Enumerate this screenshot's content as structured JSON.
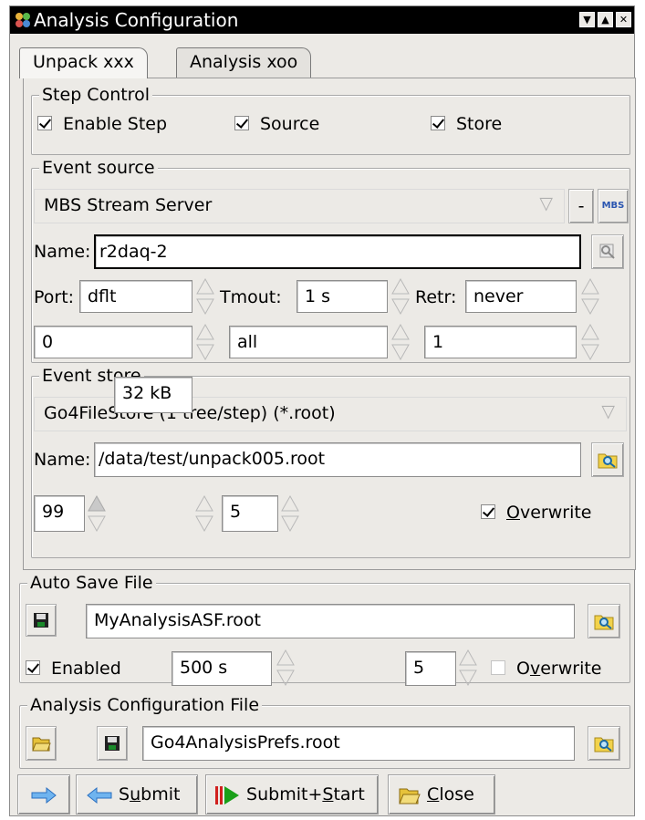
{
  "window": {
    "title": "Analysis Configuration"
  },
  "tabs": [
    {
      "label": "Unpack xxx",
      "active": true
    },
    {
      "label": "Analysis xoo",
      "active": false
    }
  ],
  "step_control": {
    "label": "Step Control",
    "checkboxes": [
      {
        "label": "Enable Step",
        "checked": true
      },
      {
        "label": "Source",
        "checked": true
      },
      {
        "label": "Store",
        "checked": true
      }
    ]
  },
  "event_source": {
    "label": "Event source",
    "type_value": "MBS Stream Server",
    "minus_label": "-",
    "mbs_label": "MBS",
    "name_label": "Name:",
    "name_value": "r2daq-2",
    "port_label": "Port:",
    "port_value": "dflt",
    "tmout_label": "Tmout:",
    "tmout_value": "1 s",
    "retr_label": "Retr:",
    "retr_value": "never",
    "row4_values": [
      "0",
      "all",
      "1"
    ]
  },
  "event_store": {
    "label": "Event store",
    "type_value": "Go4FileStore (1 tree/step) (*.root)",
    "name_label": "Name:",
    "name_value": "/data/test/unpack005.root",
    "spin_values": [
      "99",
      "32 kB",
      "5"
    ],
    "overwrite_label": "Overwrite",
    "overwrite_mnemonic": "O",
    "overwrite_rest": "verwrite",
    "overwrite_checked": true
  },
  "auto_save": {
    "label": "Auto Save File",
    "file_value": "MyAnalysisASF.root",
    "enabled_label": "Enabled",
    "enabled_checked": true,
    "interval_value": "500 s",
    "compression_value": "5",
    "overwrite_label": "Overwrite",
    "overwrite_pre": "O",
    "overwrite_mnemonic": "v",
    "overwrite_rest": "erwrite",
    "overwrite_checked": false
  },
  "config_file": {
    "label": "Analysis Configuration File",
    "file_value": "Go4AnalysisPrefs.root"
  },
  "buttons": {
    "submit_pre": "S",
    "submit_mnemonic": "u",
    "submit_rest": "bmit",
    "submit_start_pre": "Submit+",
    "submit_start_mnemonic": "S",
    "submit_start_rest": "tart",
    "close_mnemonic": "C",
    "close_rest": "lose"
  },
  "icons": {
    "app": "go4-app-icon",
    "menu": "menu-down-icon",
    "maximize": "maximize-icon",
    "close": "close-window-icon",
    "search": "file-search-icon",
    "save": "floppy-disk-icon",
    "open": "open-folder-icon",
    "arrow_right": "arrow-right-icon",
    "arrow_left": "arrow-left-icon",
    "play": "play-start-icon"
  },
  "colors": {
    "titlebar": "#000000",
    "panel": "#eceae6",
    "accent_blue": "#3a7bd5",
    "play_green": "#1aa01a",
    "stop_red": "#d0201e"
  }
}
